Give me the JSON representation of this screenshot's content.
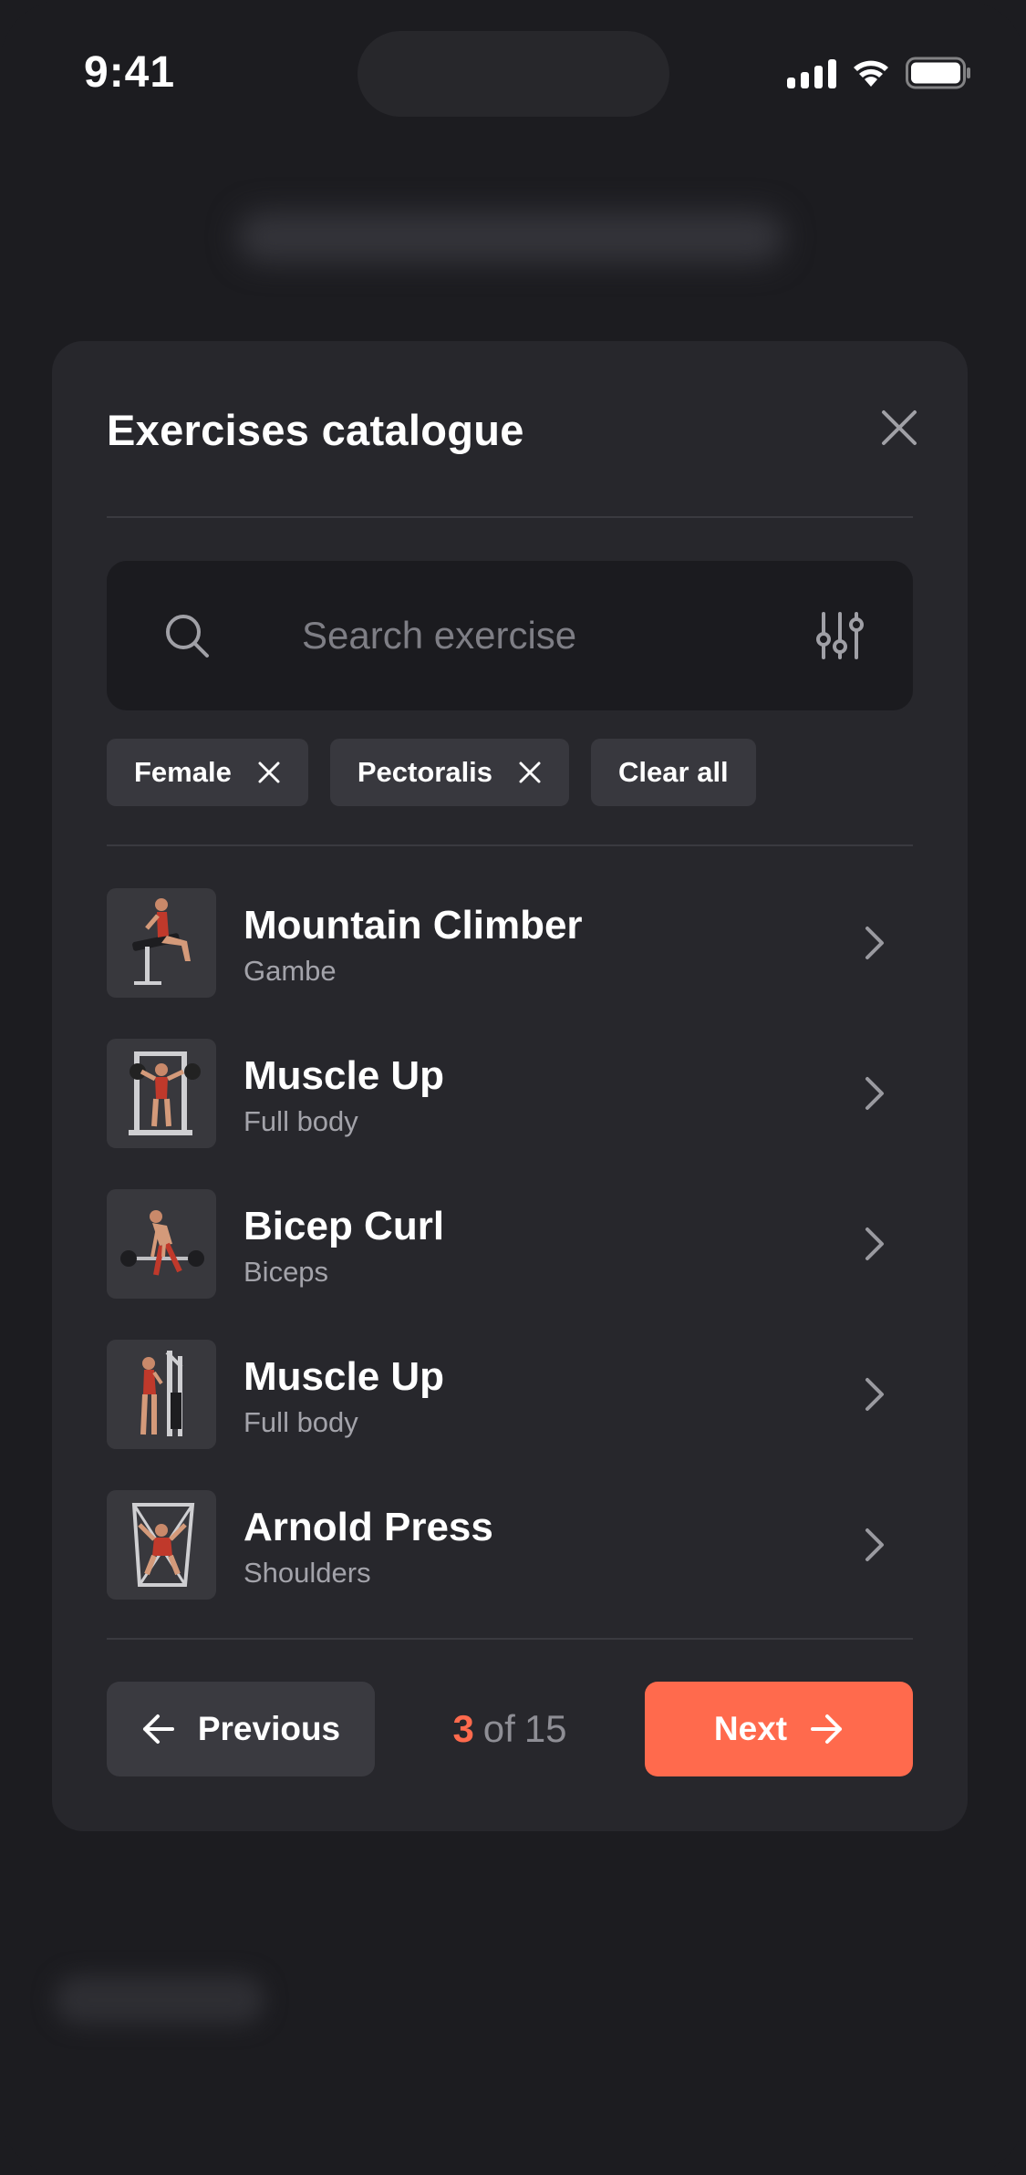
{
  "status_bar": {
    "time": "9:41",
    "icons": [
      "cellular-signal-icon",
      "wifi-icon",
      "battery-icon"
    ]
  },
  "modal": {
    "title": "Exercises catalogue",
    "close_icon": "close-icon",
    "search": {
      "placeholder": "Search exercise",
      "value": "",
      "icon": "search-icon",
      "filter_icon": "filter-sliders-icon"
    },
    "filters": [
      {
        "label": "Female",
        "icon": "close-icon"
      },
      {
        "label": "Pectoralis",
        "icon": "close-icon"
      }
    ],
    "clear_all_label": "Clear all",
    "exercises": [
      {
        "name": "Mountain Climber",
        "muscle": "Gambe"
      },
      {
        "name": "Muscle Up",
        "muscle": "Full body"
      },
      {
        "name": "Bicep Curl",
        "muscle": "Biceps"
      },
      {
        "name": "Muscle Up",
        "muscle": "Full body"
      },
      {
        "name": "Arnold Press",
        "muscle": "Shoulders"
      }
    ],
    "pagination": {
      "previous_label": "Previous",
      "next_label": "Next",
      "current_page": "3",
      "of_label": "of",
      "total_pages": "15"
    }
  },
  "colors": {
    "accent": "#ff6a4d",
    "background": "#1c1c20",
    "panel": "#27272c",
    "field": "#1b1b1f",
    "chip": "#38383e"
  }
}
